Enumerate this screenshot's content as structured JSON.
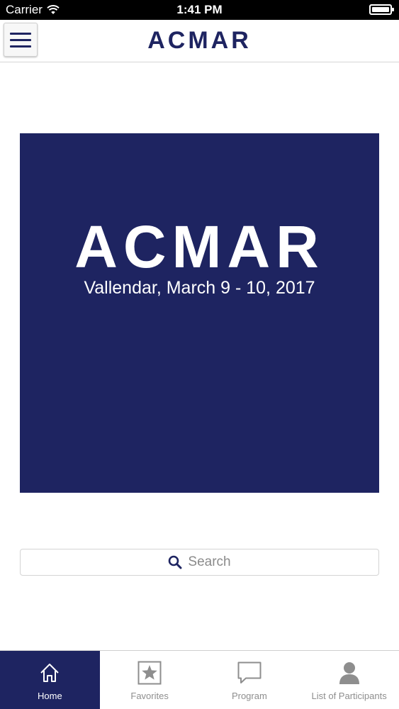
{
  "status_bar": {
    "carrier": "Carrier",
    "time": "1:41 PM"
  },
  "navbar": {
    "title": "ACMAR"
  },
  "banner": {
    "title": "ACMAR",
    "subtitle": "Vallendar, March 9 - 10, 2017"
  },
  "search": {
    "placeholder": "Search"
  },
  "tabs": [
    {
      "label": "Home",
      "icon": "home-icon",
      "active": true
    },
    {
      "label": "Favorites",
      "icon": "star-icon",
      "active": false
    },
    {
      "label": "Program",
      "icon": "speech-bubble-icon",
      "active": false
    },
    {
      "label": "List of Participants",
      "icon": "person-icon",
      "active": false
    }
  ],
  "colors": {
    "brand": "#1e2461",
    "tab_inactive": "#8e8e8e"
  }
}
